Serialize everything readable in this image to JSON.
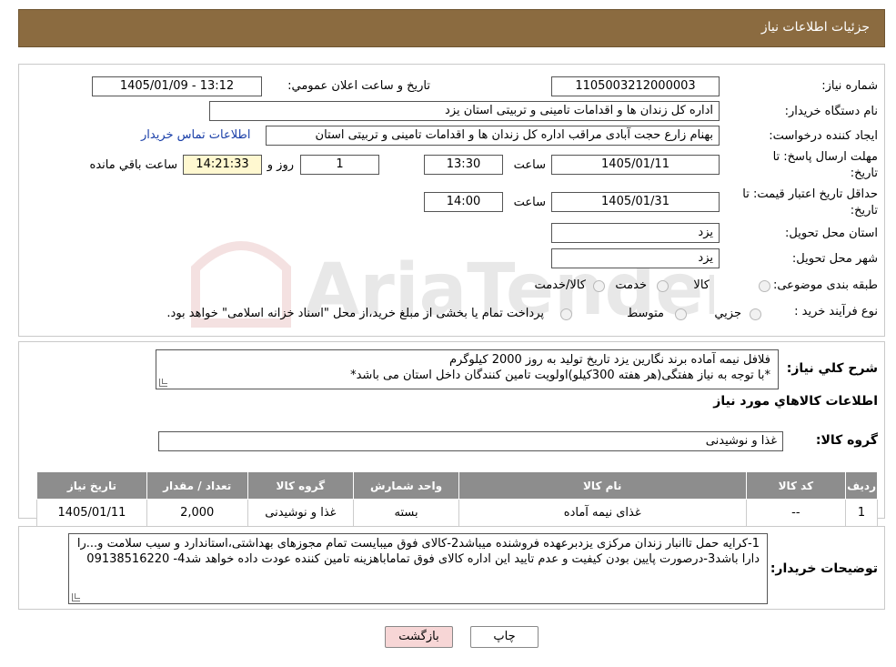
{
  "header": {
    "title": "جزئیات اطلاعات نیاز"
  },
  "form": {
    "need_number_label": "شماره نیاز:",
    "need_number": "1105003212000003",
    "announce_label": "تاریخ و ساعت اعلان عمومي:",
    "announce_value": "1405/01/09 - 13:12",
    "buyer_org_label": "نام دستگاه خريدار:",
    "buyer_org": "اداره کل زندان ها و اقدامات تامینی و تربیتی استان یزد",
    "creator_label": "ايجاد کننده درخواست:",
    "creator": "بهنام زارع حجت آبادی مراقب اداره کل زندان ها و اقدامات تامینی و تربیتی استان",
    "contact_link": "اطلاعات تماس خریدار",
    "deadline_label_1": "مهلت ارسال پاسخ: تا",
    "deadline_label_2": "تاريخ:",
    "deadline_date": "1405/01/11",
    "time_label": "ساعت",
    "deadline_time": "13:30",
    "days_value": "1",
    "days_label": "روز و",
    "remaining_time": "14:21:33",
    "remaining_label": "ساعت باقي مانده",
    "validity_label_1": "حداقل تاريخ اعتبار قيمت: تا",
    "validity_label_2": "تاريخ:",
    "validity_date": "1405/01/31",
    "validity_time_label": "ساعت",
    "validity_time": "14:00",
    "province_label": "استان محل تحويل:",
    "province": "یزد",
    "city_label": "شهر محل تحويل:",
    "city": "یزد",
    "category_label": "طبقه بندی موضوعی:",
    "category_options": [
      "کالا",
      "خدمت",
      "کالا/خدمت"
    ],
    "process_label": "نوع فرآيند خريد :",
    "process_options": [
      "جزيي",
      "متوسط"
    ],
    "process_note": "پرداخت تمام یا بخشی از مبلغ خرید،از محل \"اسناد خزانه اسلامی\" خواهد بود."
  },
  "description": {
    "label": "شرح کلي نياز:",
    "line1": "فلافل نیمه آماده برند نگارین یزد تاریخ تولید به روز 2000 کیلوگرم",
    "line2": "*با توجه به نیاز هفتگی(هر هفته 300کیلو)اولویت تامین کنندگان داخل استان می باشد*"
  },
  "goods": {
    "section_title": "اطلاعات کالاهاي مورد نياز",
    "group_label": "گروه کالا:",
    "group_value": "غذا و نوشیدنی",
    "columns": [
      "رديف",
      "کد کالا",
      "نام کالا",
      "واحد شمارش",
      "گروه کالا",
      "تعداد / مقدار",
      "تاريخ نياز"
    ],
    "rows": [
      [
        "1",
        "--",
        "غذای نیمه آماده",
        "بسته",
        "غذا و نوشیدنی",
        "2,000",
        "1405/01/11"
      ]
    ]
  },
  "buyer_notes": {
    "label": "توضيحات خريدار:",
    "text": "1-کرایه حمل تاانبار زندان مرکزی یزدبرعهده فروشنده میباشد2-کالای فوق میبایست تمام مجوزهای بهداشتی،استاندارد و سیب سلامت و...را دارا باشد3-درصورت پایین بودن کیفیت و عدم تایید این اداره کالای فوق تماماباهزینه تامین کننده عودت داده خواهد شد4- 09138516220"
  },
  "buttons": {
    "print": "چاپ",
    "back": "بازگشت"
  },
  "watermark": "AriaTender.neT",
  "colors": {
    "header_bg": "#8b6b40",
    "table_header": "#8d8d8d",
    "link": "#1a3fa8",
    "back_button": "#f7d6d6"
  }
}
